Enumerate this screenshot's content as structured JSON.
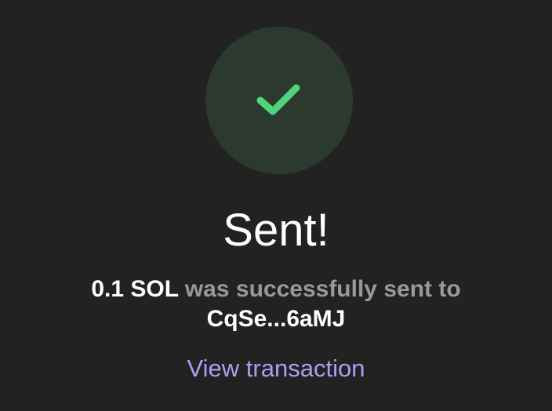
{
  "status": {
    "icon": "checkmark-icon",
    "title": "Sent!"
  },
  "message": {
    "amount": "0.1 SOL",
    "text": "was successfully sent to",
    "recipient": "CqSe...6aMJ"
  },
  "links": {
    "view_transaction": "View transaction"
  },
  "colors": {
    "background": "#222222",
    "circle": "#2c392f",
    "check": "#4fd47a",
    "muted_text": "#999999",
    "link": "#ab9ff2"
  }
}
